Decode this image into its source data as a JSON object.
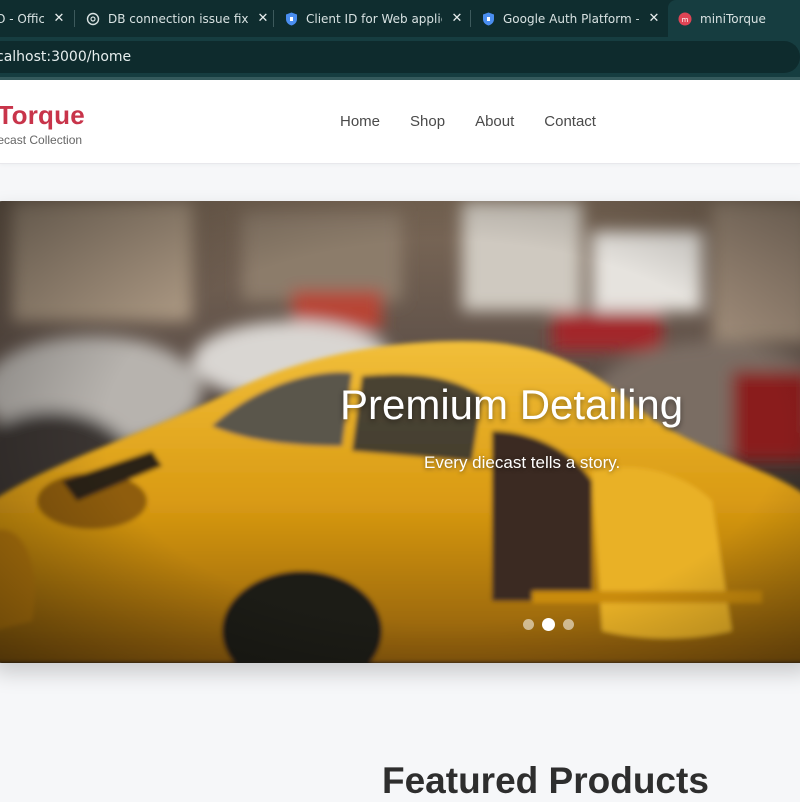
{
  "browser": {
    "tabs": [
      {
        "title": "O - Offic",
        "icon": "microsoft-office-icon"
      },
      {
        "title": "DB connection issue fix",
        "icon": "chatgpt-icon"
      },
      {
        "title": "Client ID for Web applicatio",
        "icon": "google-cloud-shield-icon"
      },
      {
        "title": "Google Auth Platform – My",
        "icon": "google-cloud-shield-icon"
      },
      {
        "title": "miniTorque",
        "icon": "minitorque-favicon"
      }
    ],
    "active_tab_index": 4,
    "url": "calhost:3000/home",
    "colors": {
      "tabstrip": "#0f2d2f",
      "active_tab": "#163d40"
    }
  },
  "site": {
    "brand": {
      "name": "niTorque",
      "tagline": "n Diecast Collection",
      "color": "#c8344a"
    },
    "nav": [
      {
        "label": "Home"
      },
      {
        "label": "Shop"
      },
      {
        "label": "About"
      },
      {
        "label": "Contact"
      }
    ],
    "hero": {
      "title": "Premium Detailing",
      "subtitle": "Every diecast tells a story.",
      "slide_count": 3,
      "active_slide": 1
    },
    "featured": {
      "heading": "Featured Products"
    }
  }
}
